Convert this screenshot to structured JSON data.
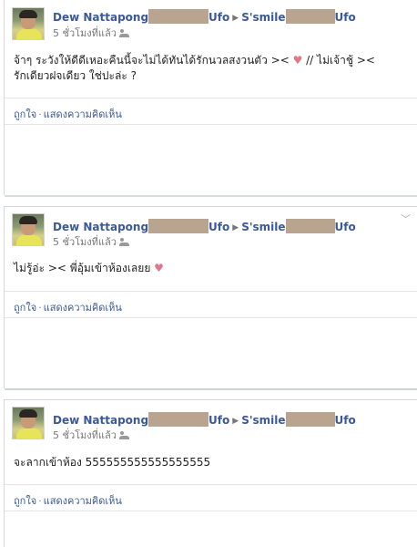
{
  "posts": [
    {
      "author": "Dew Nattapong",
      "author_suffix": "Ufo",
      "target": "S'smile",
      "target_suffix": "Ufo",
      "time": "5 ชั่วโมงที่แล้ว",
      "message_line1": "จ้าๆ ระวังให้ดีดีเหอะคืนนี้จะไม่ได้ทันได้รักนวลสงวนตัว >< ",
      "message_line1_after": " // ไม่เจ้าชู้ ><",
      "message_line2": "รักเดียวฝจเดียว ใช่ปะล่ะ ?",
      "like": "ถูกใจ",
      "comment": "แสดงความคิดเห็น"
    },
    {
      "author": "Dew Nattapong",
      "author_suffix": "Ufo",
      "target": "S'smile",
      "target_suffix": "Ufo",
      "time": "5 ชั่วโมงที่แล้ว",
      "message_line1": "ไม่รู้อ่ะ >< พี่อุ้มเข้าห้องเลยย ",
      "like": "ถูกใจ",
      "comment": "แสดงความคิดเห็น"
    },
    {
      "author": "Dew Nattapong",
      "author_suffix": "Ufo",
      "target": "S'smile",
      "target_suffix": "Ufo",
      "time": "5 ชั่วโมงที่แล้ว",
      "message_line1": "จะลากเข้าห้อง 555555555555555555",
      "like": "ถูกใจ",
      "comment": "แสดงความคิดเห็น"
    }
  ],
  "colors": {
    "link": "#3b5998",
    "heart": "#e0788a",
    "border": "#d3d6db"
  },
  "icons": [
    "avatar",
    "arrow-right-icon",
    "people-icon",
    "heart-icon",
    "chevron-down-icon"
  ]
}
